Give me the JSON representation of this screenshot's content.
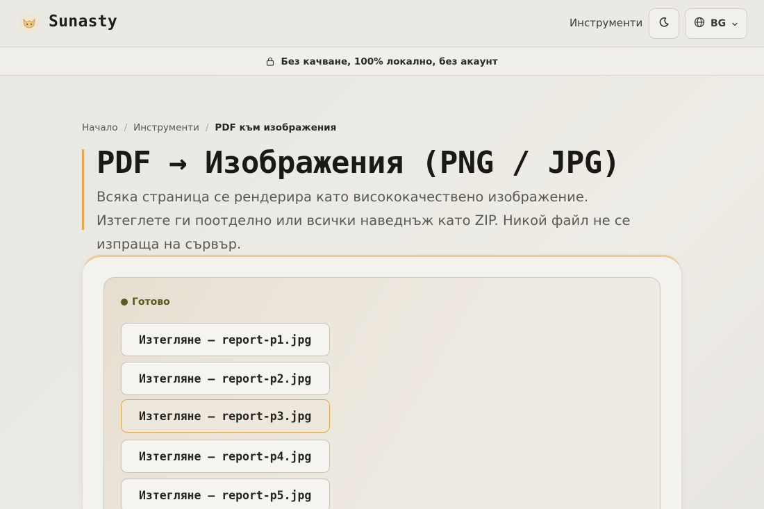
{
  "header": {
    "brand": "Sunasty",
    "nav_tools": "Инструменти",
    "lang": "BG"
  },
  "banner": {
    "text": "Без качване, 100% локално, без акаунт"
  },
  "breadcrumb": {
    "home": "Начало",
    "tools": "Инструменти",
    "current": "PDF към изображения",
    "separator": "/"
  },
  "hero": {
    "title": "PDF → Изображения (PNG / JPG)",
    "description": "Всяка страница се рендерира като висококачествено изображение. Изтеглете ги поотделно или всички наведнъж като ZIP. Никой файл не се изпраща на сървър."
  },
  "result": {
    "status": "Готово",
    "downloads": [
      {
        "label": "Изтегляне — report-p1.jpg",
        "active": false
      },
      {
        "label": "Изтегляне — report-p2.jpg",
        "active": false
      },
      {
        "label": "Изтегляне — report-p3.jpg",
        "active": true
      },
      {
        "label": "Изтегляне — report-p4.jpg",
        "active": false
      },
      {
        "label": "Изтегляне — report-p5.jpg",
        "active": false
      }
    ]
  },
  "icons": {
    "logo": "fox-logo-icon",
    "theme": "moon-icon",
    "lang": "globe-icon",
    "chevron": "chevron-down-icon",
    "lock": "lock-icon"
  },
  "colors": {
    "accent": "#e6a64b",
    "status": "#5b5a1c"
  }
}
